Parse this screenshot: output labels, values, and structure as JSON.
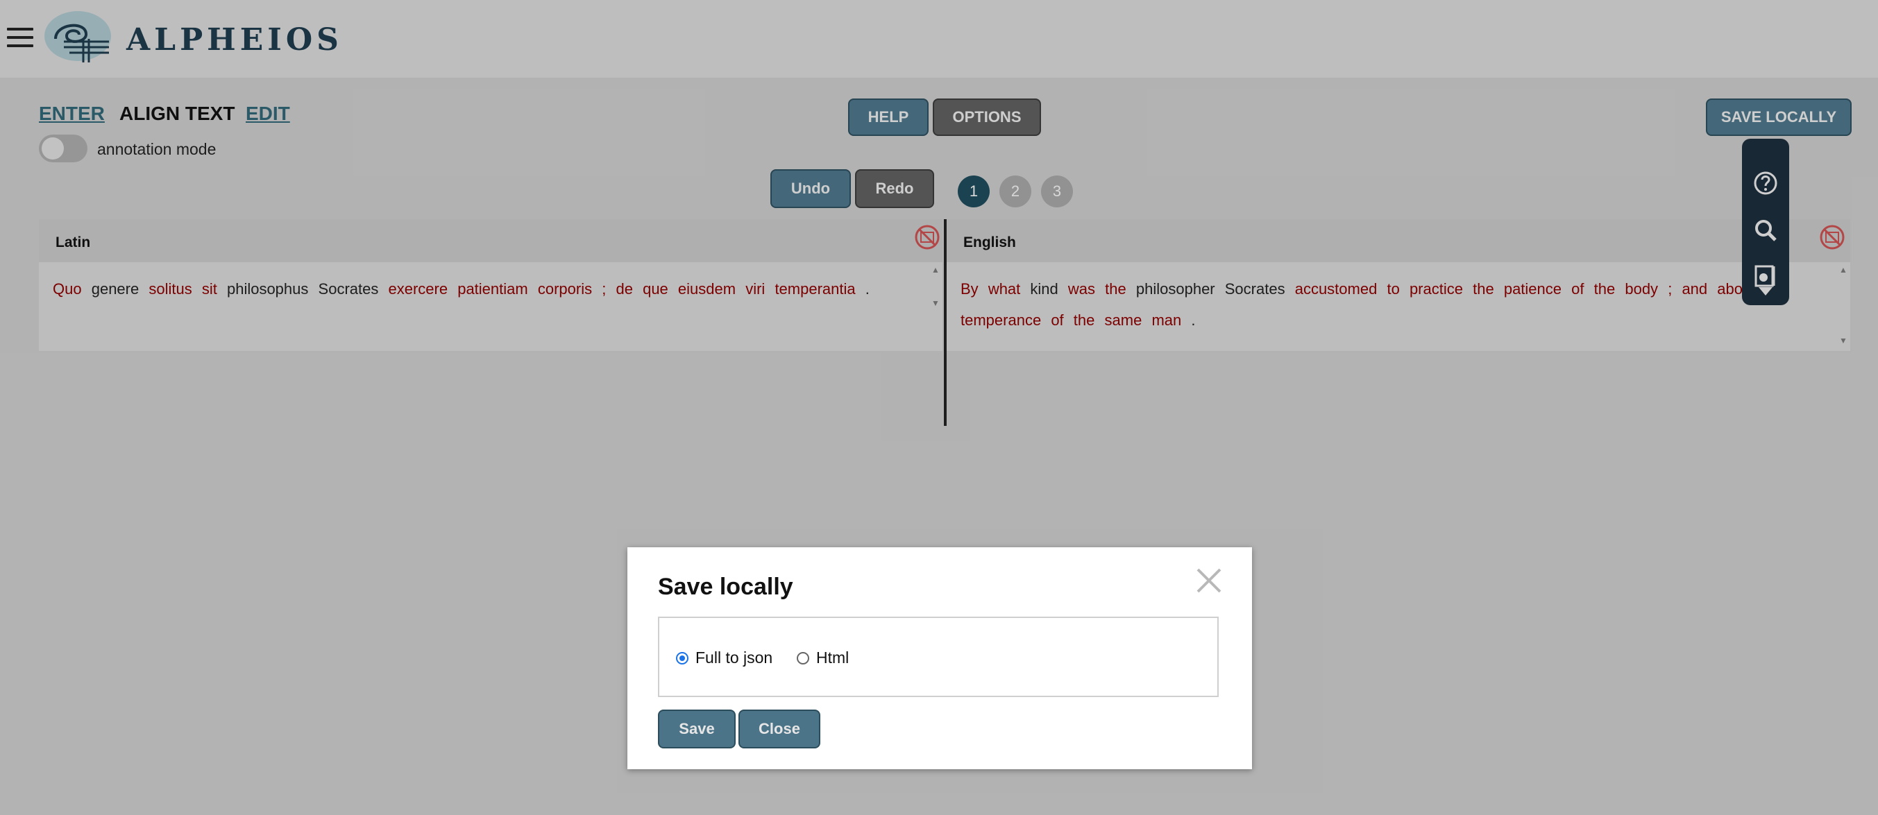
{
  "app": {
    "name": "ALPHEIOS"
  },
  "nav": {
    "enter": "ENTER",
    "align_text": "ALIGN TEXT",
    "edit": "EDIT"
  },
  "toggle": {
    "label": "annotation mode",
    "on": false
  },
  "toolbar": {
    "help": "HELP",
    "options": "OPTIONS",
    "save_locally": "SAVE LOCALLY",
    "undo": "Undo",
    "redo": "Redo"
  },
  "pages": [
    "1",
    "2",
    "3"
  ],
  "active_page": "1",
  "origin": {
    "title": "Latin",
    "words": [
      {
        "t": "Quo",
        "aligned": true
      },
      {
        "t": "genere",
        "aligned": false
      },
      {
        "t": "solitus",
        "aligned": true
      },
      {
        "t": "sit",
        "aligned": true
      },
      {
        "t": "philosophus",
        "aligned": false
      },
      {
        "t": "Socrates",
        "aligned": false
      },
      {
        "t": "exercere",
        "aligned": true
      },
      {
        "t": "patientiam",
        "aligned": true
      },
      {
        "t": "corporis",
        "aligned": true
      },
      {
        "t": ";",
        "aligned": true
      },
      {
        "t": "de",
        "aligned": true
      },
      {
        "t": "que",
        "aligned": true
      },
      {
        "t": "eiusdem",
        "aligned": true
      },
      {
        "t": "viri",
        "aligned": true
      },
      {
        "t": "temperantia",
        "aligned": true
      },
      {
        "t": ".",
        "aligned": false
      }
    ]
  },
  "target": {
    "title": "English",
    "words": [
      {
        "t": "By",
        "aligned": true
      },
      {
        "t": "what",
        "aligned": true
      },
      {
        "t": "kind",
        "aligned": false
      },
      {
        "t": "was",
        "aligned": true
      },
      {
        "t": "the",
        "aligned": true
      },
      {
        "t": "philosopher",
        "aligned": false
      },
      {
        "t": "Socrates",
        "aligned": false
      },
      {
        "t": "accustomed",
        "aligned": true
      },
      {
        "t": "to",
        "aligned": true
      },
      {
        "t": "practice",
        "aligned": true
      },
      {
        "t": "the",
        "aligned": true
      },
      {
        "t": "patience",
        "aligned": true
      },
      {
        "t": "of",
        "aligned": true
      },
      {
        "t": "the",
        "aligned": true
      },
      {
        "t": "body",
        "aligned": true
      },
      {
        "t": ";",
        "aligned": true
      },
      {
        "t": "and",
        "aligned": true
      },
      {
        "t": "about",
        "aligned": true
      },
      {
        "t": "the",
        "aligned": true
      },
      {
        "t": "temperance",
        "aligned": true
      },
      {
        "t": "of",
        "aligned": true
      },
      {
        "t": "the",
        "aligned": true
      },
      {
        "t": "same",
        "aligned": true
      },
      {
        "t": "man",
        "aligned": true
      },
      {
        "t": ".",
        "aligned": false
      }
    ]
  },
  "modal": {
    "title": "Save locally",
    "options": [
      {
        "label": "Full to json",
        "selected": true
      },
      {
        "label": "Html",
        "selected": false
      }
    ],
    "save": "Save",
    "close": "Close"
  },
  "colors": {
    "accent": "#4c7488",
    "aligned_word": "#8b0000",
    "panel_bg": "#d3d3d3",
    "toolbar_bg": "#1c2d3b"
  },
  "icons": {
    "menu": "hamburger-menu-icon",
    "logo": "alpheios-logo-icon",
    "no_annotation": "no-annotation-icon",
    "help": "help-icon",
    "search": "search-icon",
    "reading_tools": "reading-tools-icon",
    "collapse": "chevron-down-icon",
    "close": "close-icon"
  }
}
